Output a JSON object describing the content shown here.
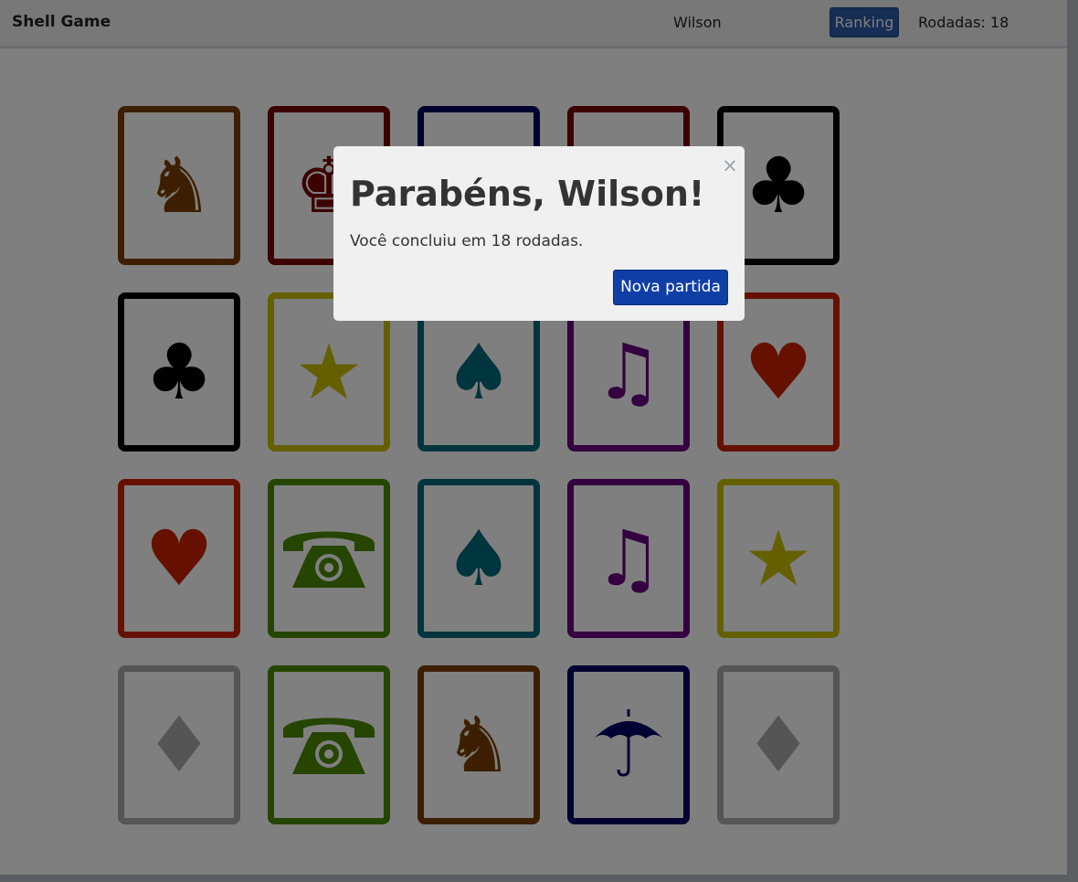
{
  "navbar": {
    "brand": "Shell Game",
    "player_name": "Wilson",
    "ranking_label": "Ranking",
    "rounds_label": "Rodadas: 18"
  },
  "board": {
    "cards": [
      {
        "symbol": "knight",
        "glyph": "♞",
        "color": "#7a3f00"
      },
      {
        "symbol": "king",
        "glyph": "♚",
        "color": "#7a0000"
      },
      {
        "symbol": "hidden",
        "glyph": "",
        "color": "#000066"
      },
      {
        "symbol": "hidden",
        "glyph": "",
        "color": "#7a0000"
      },
      {
        "symbol": "club",
        "glyph": "♣",
        "color": "#000000"
      },
      {
        "symbol": "club",
        "glyph": "♣",
        "color": "#000000"
      },
      {
        "symbol": "star",
        "glyph": "★",
        "color": "#c8c000"
      },
      {
        "symbol": "spade",
        "glyph": "♠",
        "color": "#006a7a"
      },
      {
        "symbol": "music-note",
        "glyph": "♫",
        "color": "#6a0080"
      },
      {
        "symbol": "heart",
        "glyph": "♥",
        "color": "#cc2200"
      },
      {
        "symbol": "heart",
        "glyph": "♥",
        "color": "#cc2200"
      },
      {
        "symbol": "telephone",
        "glyph": "",
        "color": "#4a8a00"
      },
      {
        "symbol": "spade",
        "glyph": "♠",
        "color": "#006a7a"
      },
      {
        "symbol": "music-note",
        "glyph": "♫",
        "color": "#6a0080"
      },
      {
        "symbol": "star",
        "glyph": "★",
        "color": "#c8c000"
      },
      {
        "symbol": "diamond",
        "glyph": "♦",
        "color": "#aaaaaa"
      },
      {
        "symbol": "telephone",
        "glyph": "",
        "color": "#4a8a00"
      },
      {
        "symbol": "knight",
        "glyph": "♞",
        "color": "#7a3f00"
      },
      {
        "symbol": "umbrella",
        "glyph": "",
        "color": "#000066"
      },
      {
        "symbol": "diamond",
        "glyph": "♦",
        "color": "#aaaaaa"
      }
    ]
  },
  "modal": {
    "title": "Parabéns, Wilson!",
    "message": "Você concluiu em 18 rodadas.",
    "close_label": "×",
    "new_game_label": "Nova partida"
  }
}
